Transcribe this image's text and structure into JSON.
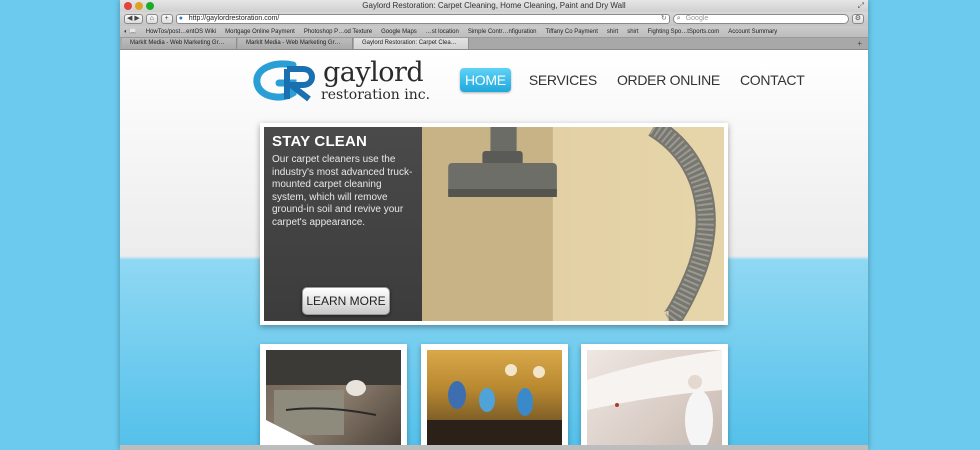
{
  "browser": {
    "window_title": "Gaylord Restoration: Carpet Cleaning, Home Cleaning, Paint and Dry Wall",
    "back_label": "◀ ▶",
    "home_label": "⌂",
    "add_label": "+",
    "url": "http://gaylordrestoration.com/",
    "search_placeholder": "Google",
    "bookmarks": [
      "HowTos/post…entOS Wiki",
      "Mortgage Online Payment",
      "Photoshop P…od Texture",
      "Google Maps",
      "…st location",
      "Simple Contr…nfiguration",
      "Tiffany Co Payment",
      "shirt",
      "shirt",
      "Fighting Spo…tSports.com",
      "Account Summary"
    ],
    "tabs": [
      "MarkIt Media - Web Marketing Gr…",
      "MarkIt Media - Web Marketing Gr…",
      "Gaylord Restoration: Carpet Clea…"
    ]
  },
  "site": {
    "logo_name": "gaylord",
    "logo_sub": "restoration inc.",
    "nav": [
      "HOME",
      "SERVICES",
      "ORDER ONLINE",
      "CONTACT"
    ],
    "hero": {
      "title": "STAY CLEAN",
      "body": "Our carpet cleaners use the industry's most advanced truck-mounted carpet cleaning system, which will remove ground-in soil and revive your carpet's appearance.",
      "button": "LEARN MORE"
    }
  },
  "colors": {
    "accent": "#29b2e4",
    "background": "#5cc1ea",
    "hero_panel": "#444444"
  }
}
